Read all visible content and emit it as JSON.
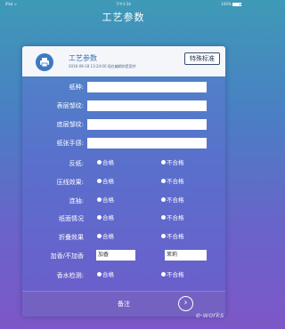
{
  "status_bar": {
    "left": "iPad ≈",
    "time": "下午1:34",
    "battery": "100%"
  },
  "nav": {
    "title": "工艺参数"
  },
  "header": {
    "title": "工艺参数",
    "meta": "2016-09-18 13:24:00 现在编辑的是案件",
    "special_label": "特殊标准",
    "icon": "printer-icon"
  },
  "text_fields": [
    {
      "label": "纸种:",
      "value": ""
    },
    {
      "label": "表层邹纹:",
      "value": ""
    },
    {
      "label": "底层邹纹:",
      "value": ""
    },
    {
      "label": "纸张手感:",
      "value": ""
    }
  ],
  "radio_rows": [
    {
      "label": "反纸:",
      "pass": "合格",
      "fail": "不合格"
    },
    {
      "label": "压线效果:",
      "pass": "合格",
      "fail": "不合格"
    },
    {
      "label": "连抽:",
      "pass": "合格",
      "fail": "不合格"
    },
    {
      "label": "纸面情况",
      "pass": "合格",
      "fail": "不合格"
    },
    {
      "label": "折叠效果",
      "pass": "合格",
      "fail": "不合格"
    }
  ],
  "fragrance": {
    "label": "加香/不加香",
    "value1": "加香",
    "value2": "茉莉"
  },
  "scent_test": {
    "label": "香水检测:",
    "pass": "合格",
    "fail": "不合格"
  },
  "footer": {
    "label": "备注",
    "arrow_icon": "chevron-right-icon"
  },
  "watermark": "e-works"
}
